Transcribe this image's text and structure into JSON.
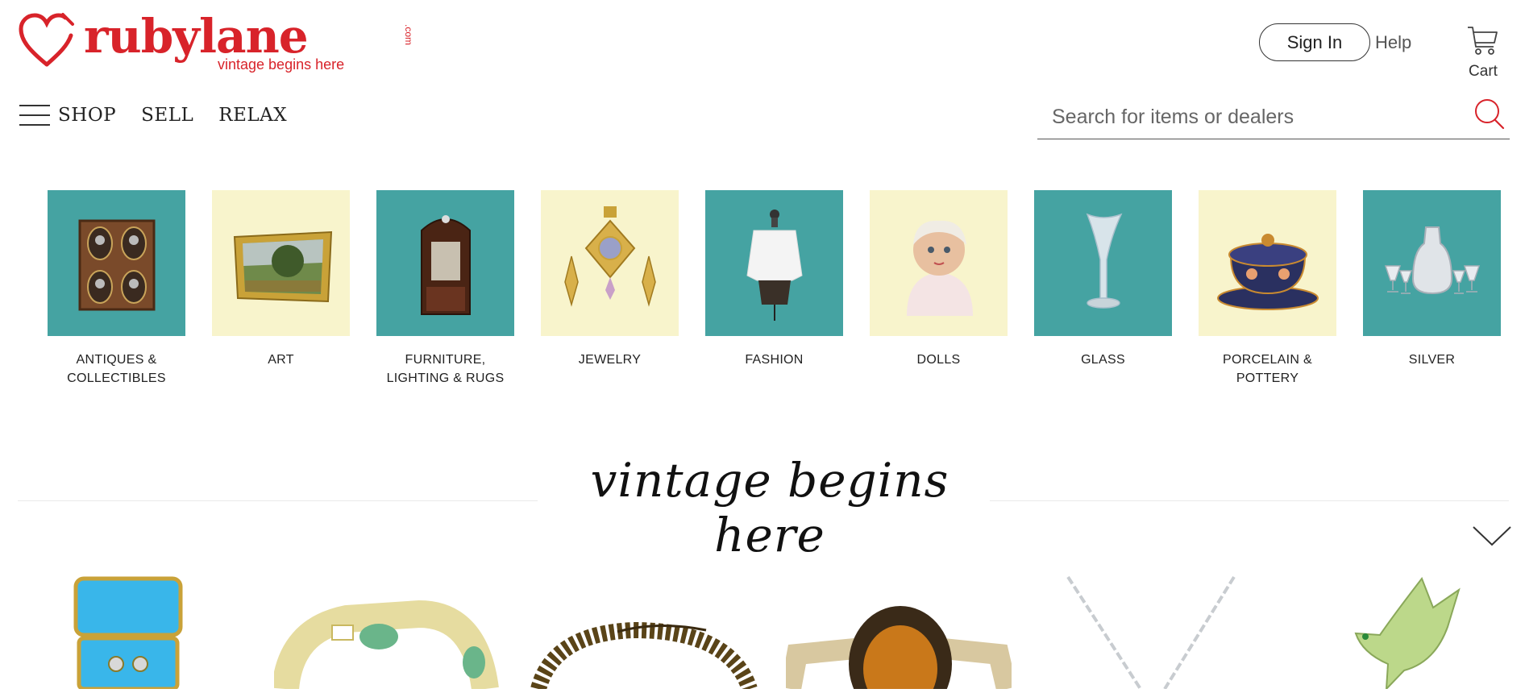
{
  "logo": {
    "name": "rubylane",
    "com": ".com",
    "tagline": "vintage begins here"
  },
  "header": {
    "signin_label": "Sign In",
    "help_label": "Help",
    "cart_label": "Cart"
  },
  "nav": {
    "shop": "SHOP",
    "sell": "SELL",
    "relax": "RELAX"
  },
  "search": {
    "placeholder": "Search for items or dealers"
  },
  "categories": [
    {
      "line1": "ANTIQUES &",
      "line2": "COLLECTIBLES"
    },
    {
      "line1": "ART",
      "line2": ""
    },
    {
      "line1": "FURNITURE,",
      "line2": "LIGHTING & RUGS"
    },
    {
      "line1": "JEWELRY",
      "line2": ""
    },
    {
      "line1": "FASHION",
      "line2": ""
    },
    {
      "line1": "DOLLS",
      "line2": ""
    },
    {
      "line1": "GLASS",
      "line2": ""
    },
    {
      "line1": "PORCELAIN &",
      "line2": "POTTERY"
    },
    {
      "line1": "SILVER",
      "line2": ""
    }
  ],
  "section": {
    "tagline": "vintage begins here"
  },
  "colors": {
    "brand_red": "#d8232a",
    "teal": "#45a3a2",
    "cream": "#f8f4cc"
  },
  "icons": [
    "heart-logo-icon",
    "cart-icon",
    "hamburger-icon",
    "search-icon",
    "chevron-down-icon"
  ]
}
